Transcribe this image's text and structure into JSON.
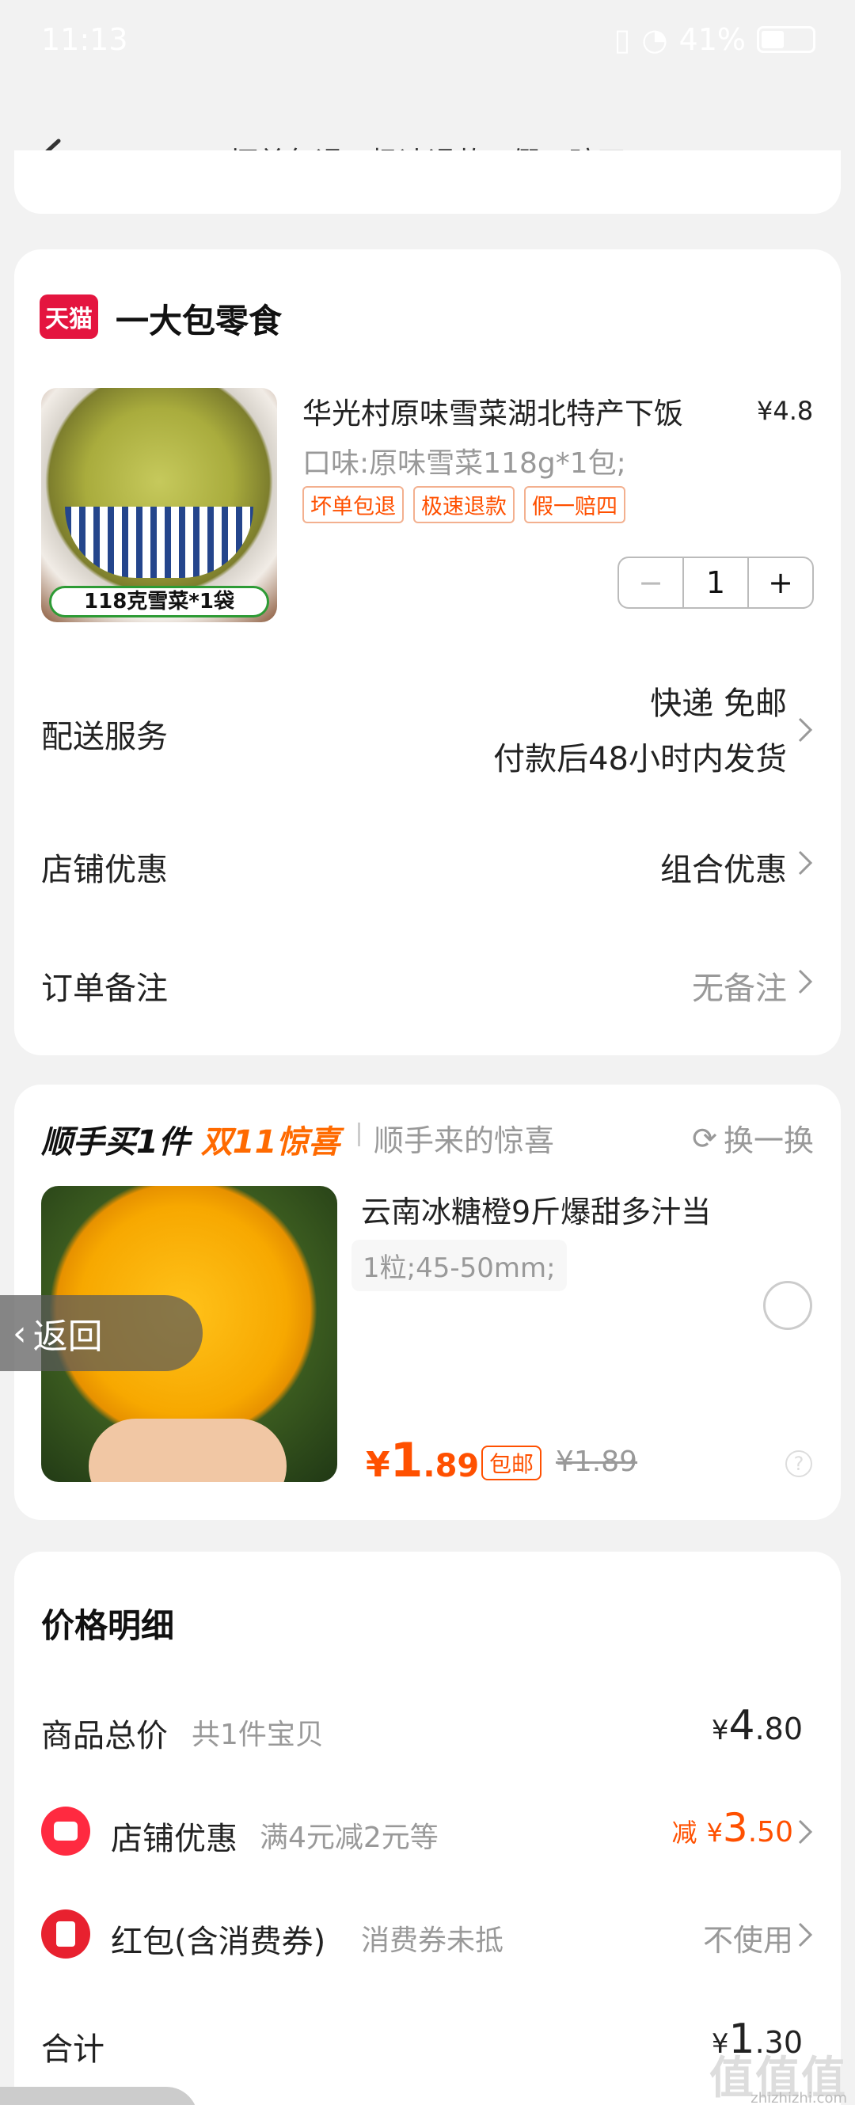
{
  "status": {
    "time": "11:13",
    "battery": "41%",
    "battery_level": 0.41
  },
  "nav": {
    "title": "坏单包退 · 极速退款 · 假一赔四"
  },
  "shop": {
    "badge": "天猫",
    "name": "一大包零食"
  },
  "product": {
    "title": "华光村原味雪菜湖北特产下饭",
    "price_symbol": "¥",
    "price": "4.8",
    "spec": "口味:原味雪菜118g*1包;",
    "badges": [
      "坏单包退",
      "极速退款",
      "假一赔四"
    ],
    "image_tag": "118克雪菜*1袋",
    "quantity": "1"
  },
  "delivery": {
    "label": "配送服务",
    "line1": "快递 免邮",
    "line2": "付款后48小时内发货"
  },
  "shop_discount": {
    "label": "店铺优惠",
    "value": "组合优惠"
  },
  "order_note": {
    "label": "订单备注",
    "value": "无备注"
  },
  "addon": {
    "title_a": "顺手买1件",
    "title_b": "双11惊喜",
    "desc": "顺手来的惊喜",
    "swap": "换一换",
    "item_title": "云南冰糖橙9斤爆甜多汁当",
    "item_spec": "1粒;45-50mm;",
    "price_symbol": "¥",
    "price_int": "1",
    "price_dec": ".89",
    "free_ship": "包邮",
    "orig_price": "¥1.89",
    "help": "?"
  },
  "back_pill": {
    "label": "返回"
  },
  "price_detail": {
    "title": "价格明细",
    "goods_total_label": "商品总价",
    "goods_total_sub": "共1件宝贝",
    "goods_total_sym": "¥",
    "goods_total_int": "4",
    "goods_total_dec": ".80",
    "shop_disc_label": "店铺优惠",
    "shop_disc_sub": "满4元减2元等",
    "shop_disc_prefix": "减",
    "shop_disc_sym": "¥",
    "shop_disc_int": "3",
    "shop_disc_dec": ".50",
    "redpack_label": "红包(含消费券)",
    "redpack_sub": "消费券未抵",
    "redpack_value": "不使用",
    "total_label": "合计",
    "total_sym": "¥",
    "total_int": "1",
    "total_dec": ".30"
  },
  "watermark": {
    "text": "值值值",
    "sub": "zhizhizhi.com"
  },
  "colors": {
    "accent": "#ff5000",
    "tmall": "#e4153f",
    "bg": "#f2f2f2"
  }
}
